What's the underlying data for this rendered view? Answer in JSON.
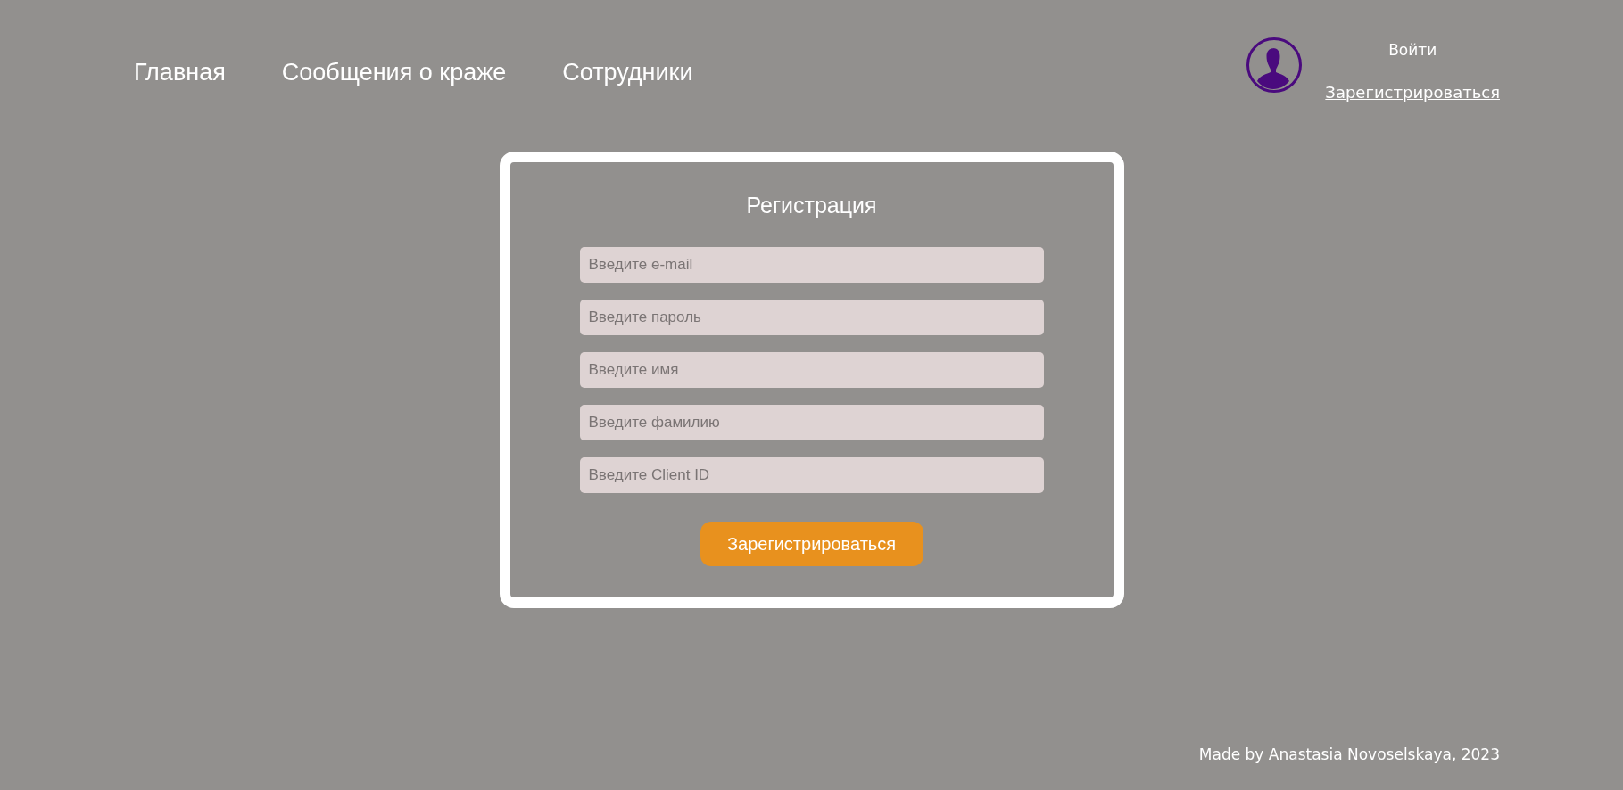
{
  "nav": [
    {
      "label": "Главная"
    },
    {
      "label": "Сообщения о краже"
    },
    {
      "label": "Сотрудники"
    }
  ],
  "auth": {
    "login": "Войти",
    "register": "Зарегистрироваться"
  },
  "form": {
    "title": "Регистрация",
    "fields": [
      {
        "placeholder": "Введите e-mail"
      },
      {
        "placeholder": "Введите пароль"
      },
      {
        "placeholder": "Введите имя"
      },
      {
        "placeholder": "Введите фамилию"
      },
      {
        "placeholder": "Введите Client ID"
      }
    ],
    "submit": "Зарегистрироваться"
  },
  "footer": "Made by Anastasia Novoselskaya, 2023"
}
